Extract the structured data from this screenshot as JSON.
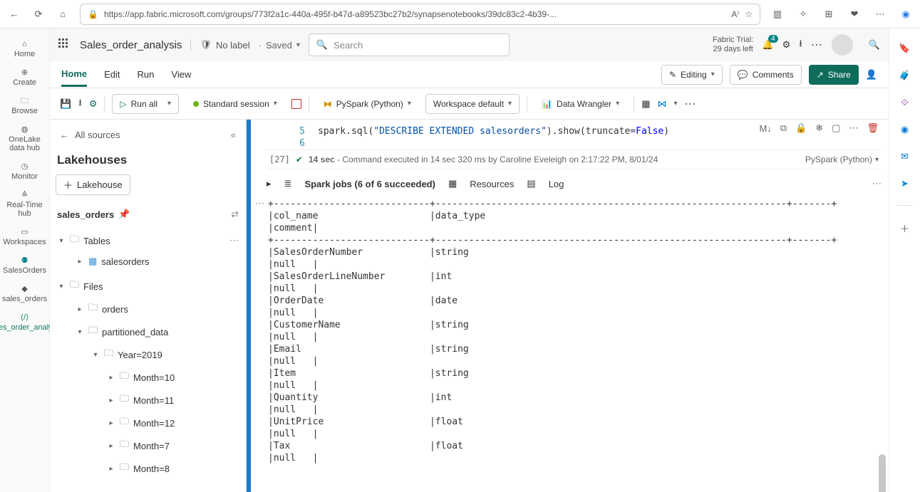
{
  "browser": {
    "url": "https://app.fabric.microsoft.com/groups/773f2a1c-440a-495f-b47d-a89523bc27b2/synapsenotebooks/39dc83c2-4b39-..."
  },
  "header": {
    "doc_title": "Sales_order_analysis",
    "sensitivity": "No label",
    "save_state": "Saved",
    "search_placeholder": "Search",
    "trial_line1": "Fabric Trial:",
    "trial_line2": "29 days left",
    "notif_count": "4"
  },
  "left_rail": [
    {
      "label": "Home"
    },
    {
      "label": "Create"
    },
    {
      "label": "Browse"
    },
    {
      "label": "OneLake data hub"
    },
    {
      "label": "Monitor"
    },
    {
      "label": "Real-Time hub"
    },
    {
      "label": "Workspaces"
    },
    {
      "label": "SalesOrders"
    },
    {
      "label": "sales_orders"
    },
    {
      "label": "Sales_order_analysis"
    }
  ],
  "tabs": {
    "items": [
      "Home",
      "Edit",
      "Run",
      "View"
    ],
    "editing_label": "Editing",
    "comments_label": "Comments",
    "share_label": "Share"
  },
  "toolbar": {
    "run_all": "Run all",
    "session": "Standard session",
    "lang": "PySpark (Python)",
    "workspace": "Workspace default",
    "wrangler": "Data Wrangler"
  },
  "lake": {
    "all_sources": "All sources",
    "title": "Lakehouses",
    "add_btn": "Lakehouse",
    "selected": "sales_orders",
    "tables_label": "Tables",
    "table_name": "salesorders",
    "files_label": "Files",
    "folder_orders": "orders",
    "folder_part": "partitioned_data",
    "year": "Year=2019",
    "months": [
      "Month=10",
      "Month=11",
      "Month=12",
      "Month=7",
      "Month=8"
    ]
  },
  "cell": {
    "line5_no": "5",
    "line6_no": "6",
    "code_prefix": "spark.sql(",
    "code_str": "\"DESCRIBE EXTENDED salesorders\"",
    "code_suffix": ").show(truncate=",
    "code_false": "False",
    "code_end": ")",
    "exec_id": "[27]",
    "exec_time": "14 sec",
    "exec_msg": "- Command executed in 14 sec 320 ms by Caroline Eveleigh on 2:17:22 PM, 8/01/24",
    "cell_lang": "PySpark (Python)"
  },
  "jobs": {
    "spark_label": "Spark jobs (6 of 6 succeeded)",
    "resources": "Resources",
    "log": "Log"
  },
  "output_text": "+----------------------------+---------------------------------------------------------------+-------+\n|col_name                    |data_type                                                      \n|comment|\n+----------------------------+---------------------------------------------------------------+-------+\n|SalesOrderNumber            |string                                                         \n|null   |\n|SalesOrderLineNumber        |int                                                            \n|null   |\n|OrderDate                   |date                                                           \n|null   |\n|CustomerName                |string                                                         \n|null   |\n|Email                       |string                                                         \n|null   |\n|Item                        |string                                                         \n|null   |\n|Quantity                    |int                                                            \n|null   |\n|UnitPrice                   |float                                                          \n|null   |\n|Tax                         |float                                                          \n|null   |"
}
